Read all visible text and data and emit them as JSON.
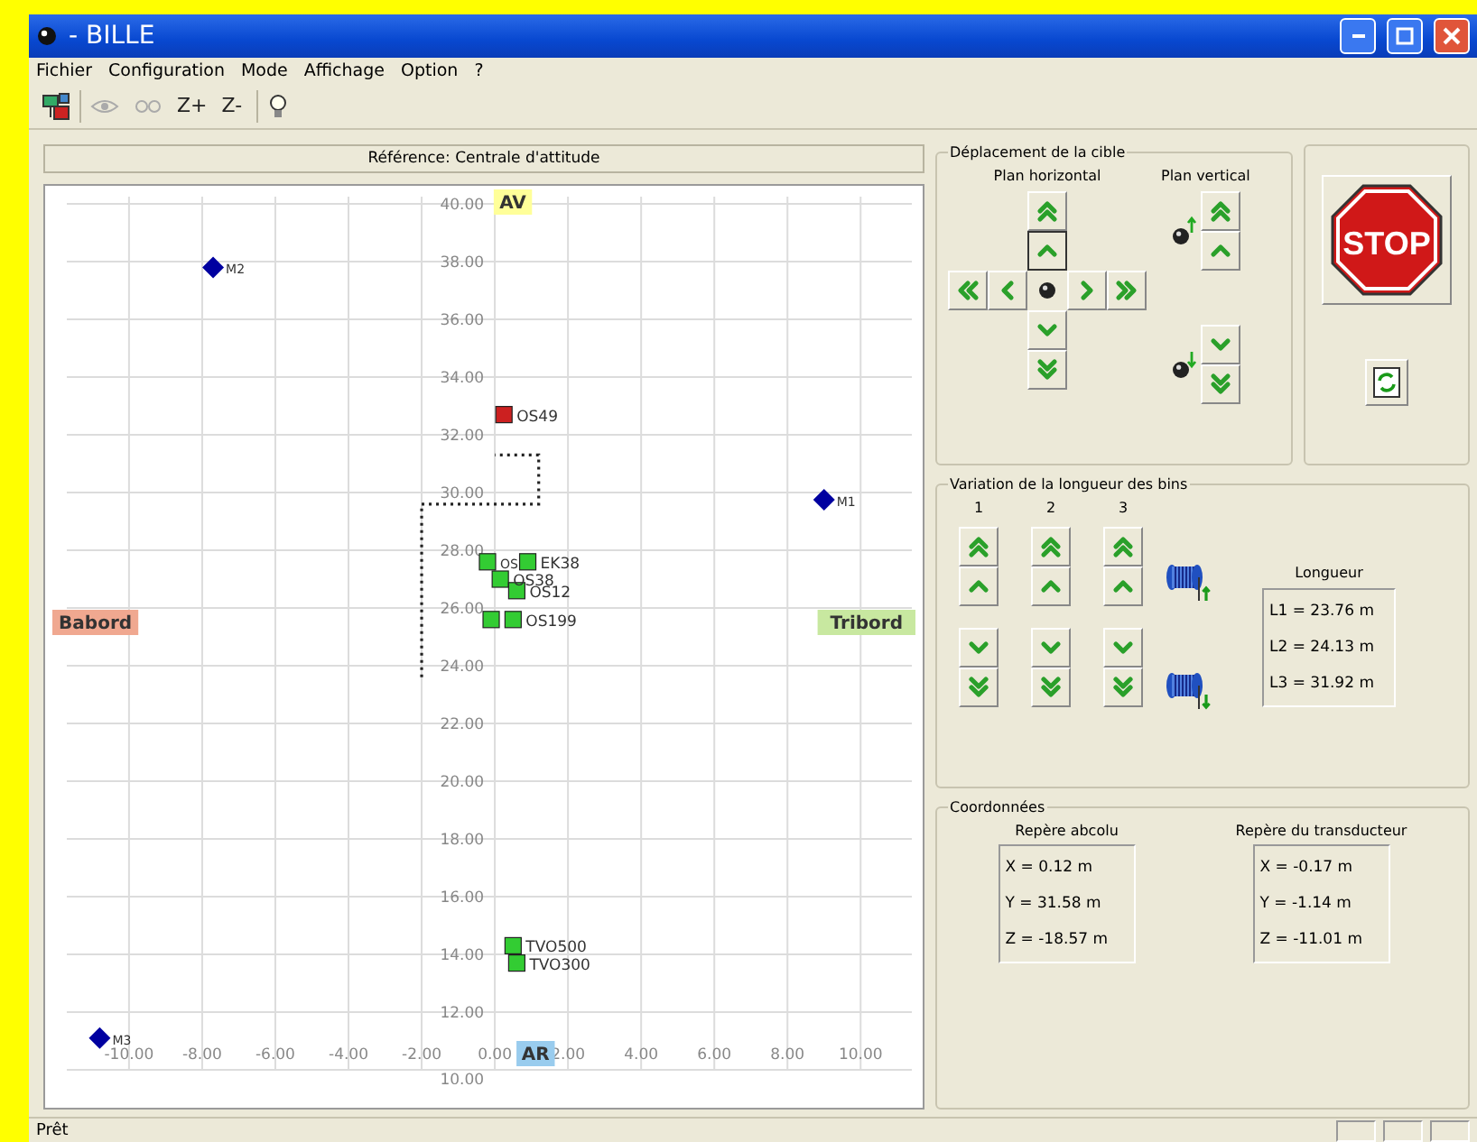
{
  "window": {
    "title": "- BILLE"
  },
  "menu": [
    "Fichier",
    "Configuration",
    "Mode",
    "Affichage",
    "Option",
    "?"
  ],
  "toolbar": [
    {
      "kind": "network",
      "disabled": false
    },
    {
      "kind": "eye",
      "disabled": true
    },
    {
      "kind": "eyes",
      "disabled": true
    },
    {
      "kind": "text",
      "label": "Z+",
      "disabled": false
    },
    {
      "kind": "text",
      "label": "Z-",
      "disabled": false
    },
    {
      "kind": "bulb",
      "disabled": false
    }
  ],
  "chart": {
    "header": "Référence: Centrale d'attitude",
    "direction_labels": [
      {
        "text": "AV",
        "kind": "top",
        "color": "#ffff99"
      },
      {
        "text": "AR",
        "kind": "bottom",
        "color": "#99ccee"
      },
      {
        "text": "Babord",
        "kind": "left",
        "color": "#f0a890"
      },
      {
        "text": "Tribord",
        "kind": "right",
        "color": "#c8e8a0"
      }
    ],
    "series_markers": [
      {
        "kind": "diamond"
      },
      {
        "kind": "square"
      },
      {
        "kind": "square"
      },
      {
        "kind": "dots"
      }
    ],
    "chart_data": {
      "type": "scatter",
      "xlim": [
        -11.7,
        11.4
      ],
      "grid": true,
      "ylim": [
        10,
        40
      ],
      "xticks": [
        {
          "value": -10,
          "label": "-10.00"
        },
        {
          "value": -8,
          "label": "-8.00"
        },
        {
          "value": -6,
          "label": "-6.00"
        },
        {
          "value": -4,
          "label": "-4.00"
        },
        {
          "value": -2,
          "label": "-2.00"
        },
        {
          "value": 0,
          "label": "0.00"
        },
        {
          "value": 2,
          "label": "2.00"
        },
        {
          "value": 4,
          "label": "4.00"
        },
        {
          "value": 6,
          "label": "6.00"
        },
        {
          "value": 8,
          "label": "8.00"
        },
        {
          "value": 10,
          "label": "10.00"
        }
      ],
      "yticks": [
        {
          "value": 10,
          "label": "10.00"
        },
        {
          "value": 12,
          "label": "12.00"
        },
        {
          "value": 14,
          "label": "14.00"
        },
        {
          "value": 16,
          "label": "16.00"
        },
        {
          "value": 18,
          "label": "18.00"
        },
        {
          "value": 20,
          "label": "20.00"
        },
        {
          "value": 22,
          "label": "22.00"
        },
        {
          "value": 24,
          "label": "24.00"
        },
        {
          "value": 26,
          "label": "26.00"
        },
        {
          "value": 28,
          "label": "28.00"
        },
        {
          "value": 30,
          "label": "30.00"
        },
        {
          "value": 32,
          "label": "32.00"
        },
        {
          "value": 34,
          "label": "34.00"
        },
        {
          "value": 36,
          "label": "36.00"
        },
        {
          "value": 38,
          "label": "38.00"
        },
        {
          "value": 40,
          "label": "40.00"
        }
      ],
      "series": [
        {
          "color": "#0000a0",
          "x": [
            9.0,
            -7.7,
            -10.8
          ],
          "values": [
            29.75,
            37.8,
            11.1
          ]
        },
        {
          "color": "#cc2020",
          "x": [
            0.25
          ],
          "values": [
            32.7
          ]
        },
        {
          "color": "#33cc33",
          "x": [
            -0.2,
            0.9,
            0.15,
            0.6,
            -0.1,
            0.5,
            0.5,
            0.6
          ],
          "values": [
            27.6,
            27.6,
            27.0,
            26.6,
            25.6,
            25.6,
            14.3,
            13.7
          ]
        },
        {
          "type": "line",
          "line_style": "dotted",
          "color": "#222222",
          "x": [
            -2,
            -2,
            -2,
            -2,
            -2,
            -2,
            -2,
            -2,
            -2,
            -2,
            -2,
            -1.4,
            -0.7,
            0,
            0.6,
            1.2,
            1.2,
            1.2,
            1.2,
            1.2,
            0.6,
            0
          ],
          "values": [
            23.6,
            24.2,
            24.8,
            25.4,
            26,
            26.6,
            27.2,
            27.8,
            28.4,
            29,
            29.6,
            29.6,
            29.6,
            29.6,
            29.6,
            29.6,
            30.2,
            30.6,
            31,
            31.3,
            31.3,
            31.3
          ]
        }
      ],
      "annotations": [
        {
          "x": 9.0,
          "y": 29.75,
          "text": "M1"
        },
        {
          "x": -7.7,
          "y": 37.8,
          "text": "M2"
        },
        {
          "x": -10.8,
          "y": 11.1,
          "text": "M3"
        },
        {
          "x": 0.25,
          "y": 32.7,
          "text": "OS49"
        },
        {
          "x": -0.2,
          "y": 27.6,
          "text": "OS"
        },
        {
          "x": 0.9,
          "y": 27.6,
          "text": "EK38"
        },
        {
          "x": 0.15,
          "y": 27.0,
          "text": "OS38"
        },
        {
          "x": 0.6,
          "y": 26.6,
          "text": "OS12"
        },
        {
          "x": 0.5,
          "y": 25.6,
          "text": "OS199"
        },
        {
          "x": 0.5,
          "y": 14.3,
          "text": "TVO500"
        },
        {
          "x": 0.6,
          "y": 13.7,
          "text": "TVO300"
        }
      ]
    }
  },
  "target": {
    "title": "Déplacement de la cible",
    "horizontal_label": "Plan horizontal",
    "vertical_label": "Plan vertical",
    "horizontal_buttons": [
      {
        "kind": "up2",
        "focused": false
      },
      {
        "kind": "up",
        "focused": true
      },
      {
        "kind": "left2",
        "focused": false
      },
      {
        "kind": "left",
        "focused": false
      },
      {
        "kind": "right",
        "focused": false
      },
      {
        "kind": "right2",
        "focused": false
      },
      {
        "kind": "down",
        "focused": false
      },
      {
        "kind": "down2",
        "focused": false
      }
    ]
  },
  "cables": {
    "title": "Variation de la longueur des bins",
    "columns": [
      "1",
      "2",
      "3"
    ],
    "length_label": "Longueur",
    "lengths": [
      "L1 = 23.76 m",
      "L2 = 24.13 m",
      "L3 = 31.92 m"
    ]
  },
  "coordinates": {
    "title": "Coordonnées",
    "frames": [
      {
        "label": "Repère abcolu",
        "values": [
          "X = 0.12 m",
          "Y = 31.58 m",
          "Z = -18.57 m"
        ]
      },
      {
        "label": "Repère du transducteur",
        "values": [
          "X = -0.17 m",
          "Y = -1.14 m",
          "Z = -11.01 m"
        ]
      }
    ]
  },
  "stop_button": {
    "label": "STOP"
  },
  "status_bar": {
    "text": "Prêt"
  }
}
